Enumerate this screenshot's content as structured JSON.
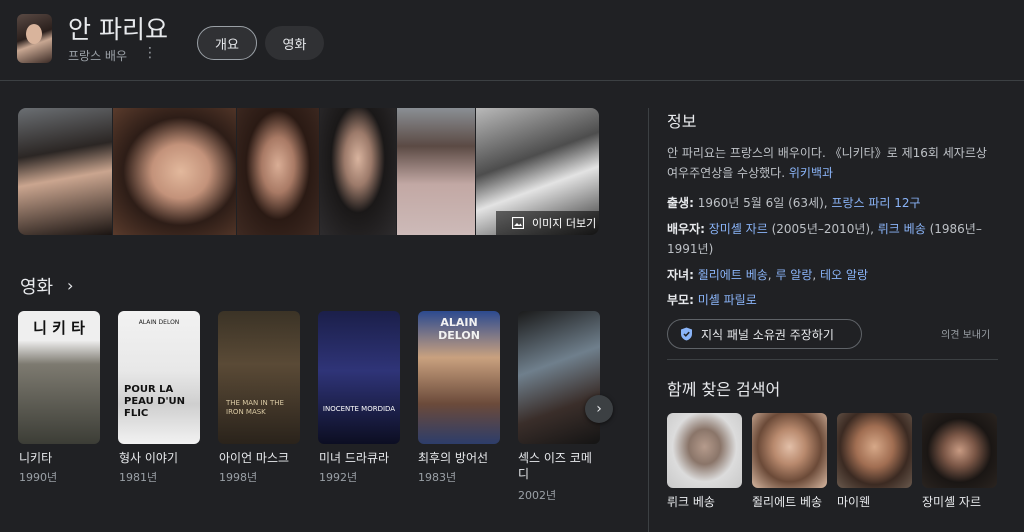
{
  "header": {
    "title": "안 파리요",
    "subtitle": "프랑스 배우",
    "tabs": [
      {
        "label": "개요"
      },
      {
        "label": "영화"
      }
    ]
  },
  "gallery": {
    "more_label": "이미지 더보기"
  },
  "movies": {
    "section_title": "영화",
    "items": [
      {
        "title": "니키타",
        "year": "1990년",
        "poster_text": "니 키 타"
      },
      {
        "title": "형사 이야기",
        "year": "1981년",
        "poster_text": "POUR LA PEAU D'UN FLIC",
        "poster_top": "ALAIN DELON"
      },
      {
        "title": "아이언 마스크",
        "year": "1998년",
        "poster_text": "THE MAN IN THE IRON MASK"
      },
      {
        "title": "미녀 드라큐라",
        "year": "1992년",
        "poster_text": "INOCENTE MORDIDA"
      },
      {
        "title": "최후의 방어선",
        "year": "1983년",
        "poster_text": "ALAIN DELON"
      },
      {
        "title": "섹스 이즈 코메디",
        "year": "2002년",
        "poster_text": ""
      }
    ]
  },
  "info": {
    "title": "정보",
    "description": "안 파리요는 프랑스의 배우이다. 《니키타》로 제16회 세자르상 여우주연상을 수상했다.",
    "source_link": "위키백과",
    "born_label": "출생:",
    "born_value": "1960년 5월 6일 (63세),",
    "born_link": "프랑스 파리 12구",
    "spouse_label": "배우자:",
    "spouse_1": "장미셸 자르",
    "spouse_1_years": "(2005년–2010년),",
    "spouse_2": "뤼크 베송",
    "spouse_2_years": "(1986년–1991년)",
    "children_label": "자녀:",
    "child_1": "쥘리에트 베송",
    "child_2": "루 알랑",
    "child_3": "테오 알랑",
    "parents_label": "부모:",
    "parent_1": "미셸 파릴로",
    "claim_label": "지식 패널 소유권 주장하기",
    "feedback_label": "의견 보내기"
  },
  "related": {
    "title": "함께 찾은 검색어",
    "items": [
      {
        "name": "뤼크 베송"
      },
      {
        "name": "쥘리에트 베송"
      },
      {
        "name": "마이웬"
      },
      {
        "name": "장미셸 자르"
      }
    ]
  },
  "colors": {
    "background": "#202124",
    "link": "#8ab4f8",
    "text": "#e8eaed",
    "muted": "#9aa0a6"
  }
}
